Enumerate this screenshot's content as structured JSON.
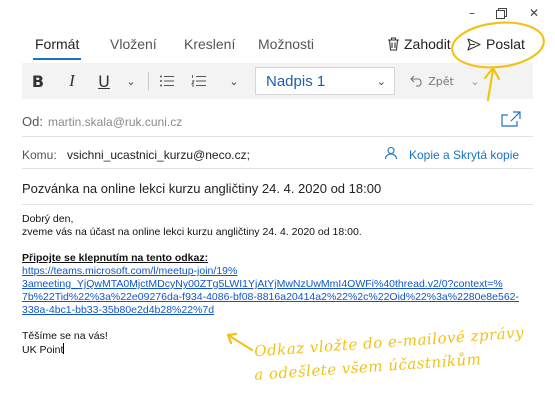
{
  "window": {
    "minimize_glyph": "–",
    "close_glyph": "✕"
  },
  "tabs": [
    {
      "label": "Formát",
      "active": true
    },
    {
      "label": "Vložení"
    },
    {
      "label": "Kreslení"
    },
    {
      "label": "Možnosti"
    }
  ],
  "actions": {
    "discard_label": "Zahodit",
    "send_label": "Poslat"
  },
  "toolbar": {
    "bold": "B",
    "italic": "I",
    "underline": "U",
    "style_value": "Nadpis 1",
    "undo_label": "Zpět",
    "chevron": "⌄"
  },
  "fields": {
    "from_label": "Od:",
    "from_value": "martin.skala@ruk.cuni.cz",
    "to_label": "Komu:",
    "to_value": "vsichni_ucastnici_kurzu@neco.cz;",
    "cc_link": "Kopie a Skrytá kopie",
    "subject": "Pozvánka na online lekci kurzu angličtiny 24. 4. 2020 od 18:00"
  },
  "body": {
    "greeting": "Dobrý den,",
    "invite": "zveme vás na účast na online lekci kurzu angličtiny 24. 4. 2020 od 18:00.",
    "join_heading": "Připojte se klepnutím na tento odkaz:",
    "link_lines": [
      "https://teams.microsoft.com/l/meetup-join/19%",
      "3ameeting_YjQwMTA0MjctMDcyNy00ZTg5LWI1YjAtYjMwNzUwMmI4OWFi%40thread.v2/0?context=%",
      "7b%22Tid%22%3a%22e09276da-f934-4086-bf08-8816a20414a2%22%2c%22Oid%22%3a%2280e8e562-",
      "338a-4bc1-bb33-35b80e2d4b28%22%7d"
    ],
    "closing": "Těšíme se na vás!",
    "signature": "UK Point"
  },
  "annotation": {
    "line1": "Odkaz vložte do e-mailové zprávy",
    "line2": "a odešlete všem účastníkům",
    "color": "#f2c21a"
  }
}
